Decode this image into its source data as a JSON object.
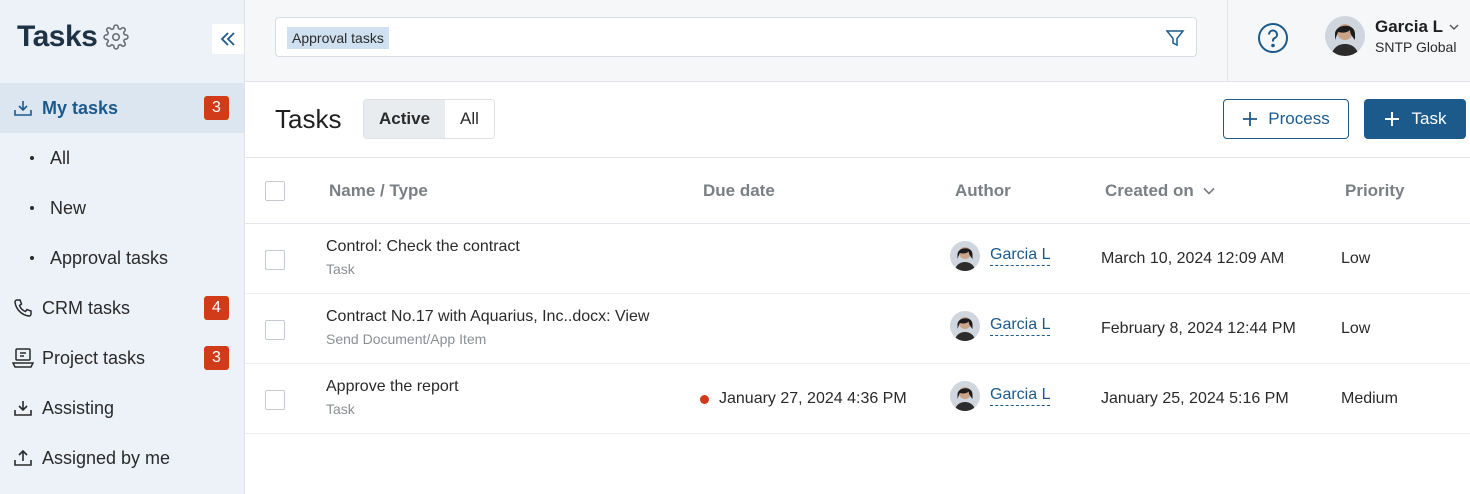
{
  "sidebar": {
    "title": "Tasks",
    "items": [
      {
        "label": "My tasks",
        "badge": "3",
        "icon": "inbox-download-icon"
      },
      {
        "label": "All"
      },
      {
        "label": "New"
      },
      {
        "label": "Approval tasks"
      },
      {
        "label": "CRM tasks",
        "badge": "4",
        "icon": "phone-icon"
      },
      {
        "label": "Project tasks",
        "badge": "3",
        "icon": "project-icon"
      },
      {
        "label": "Assisting",
        "icon": "tray-in-icon"
      },
      {
        "label": "Assigned by me",
        "icon": "tray-out-icon"
      }
    ]
  },
  "topbar": {
    "search_chip": "Approval tasks",
    "user_name": "Garcia L",
    "user_org": "SNTP Global"
  },
  "main": {
    "title": "Tasks",
    "tabs": [
      "Active",
      "All"
    ],
    "active_tab": "Active",
    "process_label": "Process",
    "task_label": "Task"
  },
  "table": {
    "columns": [
      "Name / Type",
      "Due date",
      "Author",
      "Created on",
      "Priority"
    ],
    "rows": [
      {
        "title": "Control: Check the contract",
        "type": "Task",
        "due": "",
        "author": "Garcia L",
        "created": "March 10, 2024 12:09 AM",
        "priority": "Low"
      },
      {
        "title": "Contract No.17 with Aquarius, Inc..docx: View",
        "type": "Send Document/App Item",
        "due": "",
        "author": "Garcia L",
        "created": "February 8, 2024 12:44 PM",
        "priority": "Low"
      },
      {
        "title": "Approve the report",
        "type": "Task",
        "due": "January 27, 2024 4:36 PM",
        "author": "Garcia L",
        "created": "January 25, 2024 5:16 PM",
        "priority": "Medium"
      }
    ]
  },
  "colors": {
    "accent": "#1d5a8c",
    "badge": "#d23b1a",
    "sidebar_bg": "#edf2f8"
  }
}
